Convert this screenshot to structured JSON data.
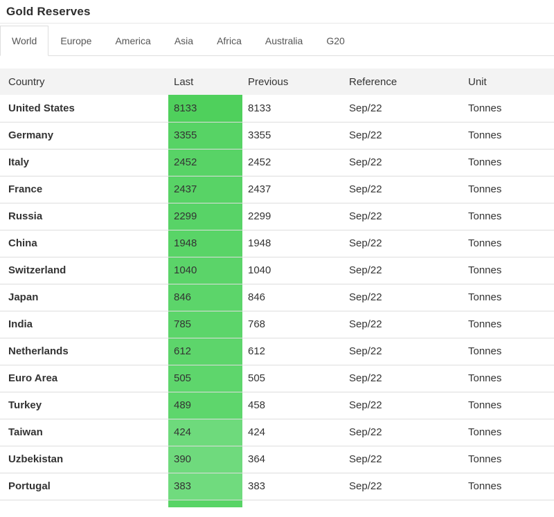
{
  "page_title": "Gold Reserves",
  "tabs": {
    "items": [
      {
        "label": "World",
        "active": true
      },
      {
        "label": "Europe",
        "active": false
      },
      {
        "label": "America",
        "active": false
      },
      {
        "label": "Asia",
        "active": false
      },
      {
        "label": "Africa",
        "active": false
      },
      {
        "label": "Australia",
        "active": false
      },
      {
        "label": "G20",
        "active": false
      }
    ]
  },
  "table": {
    "headers": [
      "Country",
      "Last",
      "Previous",
      "Reference",
      "Unit"
    ],
    "rows": [
      {
        "country": "United States",
        "last": "8133",
        "previous": "8133",
        "reference": "Sep/22",
        "unit": "Tonnes",
        "last_bg": "#4fd05c"
      },
      {
        "country": "Germany",
        "last": "3355",
        "previous": "3355",
        "reference": "Sep/22",
        "unit": "Tonnes",
        "last_bg": "#57d365"
      },
      {
        "country": "Italy",
        "last": "2452",
        "previous": "2452",
        "reference": "Sep/22",
        "unit": "Tonnes",
        "last_bg": "#58d366"
      },
      {
        "country": "France",
        "last": "2437",
        "previous": "2437",
        "reference": "Sep/22",
        "unit": "Tonnes",
        "last_bg": "#58d366"
      },
      {
        "country": "Russia",
        "last": "2299",
        "previous": "2299",
        "reference": "Sep/22",
        "unit": "Tonnes",
        "last_bg": "#58d367"
      },
      {
        "country": "China",
        "last": "1948",
        "previous": "1948",
        "reference": "Sep/22",
        "unit": "Tonnes",
        "last_bg": "#59d467"
      },
      {
        "country": "Switzerland",
        "last": "1040",
        "previous": "1040",
        "reference": "Sep/22",
        "unit": "Tonnes",
        "last_bg": "#5bd469"
      },
      {
        "country": "Japan",
        "last": "846",
        "previous": "846",
        "reference": "Sep/22",
        "unit": "Tonnes",
        "last_bg": "#5cd56a"
      },
      {
        "country": "India",
        "last": "785",
        "previous": "768",
        "reference": "Sep/22",
        "unit": "Tonnes",
        "last_bg": "#5cd56a"
      },
      {
        "country": "Netherlands",
        "last": "612",
        "previous": "612",
        "reference": "Sep/22",
        "unit": "Tonnes",
        "last_bg": "#5dd56b"
      },
      {
        "country": "Euro Area",
        "last": "505",
        "previous": "505",
        "reference": "Sep/22",
        "unit": "Tonnes",
        "last_bg": "#5ed66c"
      },
      {
        "country": "Turkey",
        "last": "489",
        "previous": "458",
        "reference": "Sep/22",
        "unit": "Tonnes",
        "last_bg": "#5ed66c"
      },
      {
        "country": "Taiwan",
        "last": "424",
        "previous": "424",
        "reference": "Sep/22",
        "unit": "Tonnes",
        "last_bg": "#6eda7c"
      },
      {
        "country": "Uzbekistan",
        "last": "390",
        "previous": "364",
        "reference": "Sep/22",
        "unit": "Tonnes",
        "last_bg": "#6fda7d"
      },
      {
        "country": "Portugal",
        "last": "383",
        "previous": "383",
        "reference": "Sep/22",
        "unit": "Tonnes",
        "last_bg": "#70db7e"
      }
    ],
    "partial_next_row": {
      "last_bg": "#58d466"
    }
  },
  "colors": {
    "row_border": "#dddddd",
    "header_bg": "#f3f3f3",
    "text": "#333333",
    "tab_border": "#dddddd",
    "title_divider": "#e7e7e7"
  }
}
